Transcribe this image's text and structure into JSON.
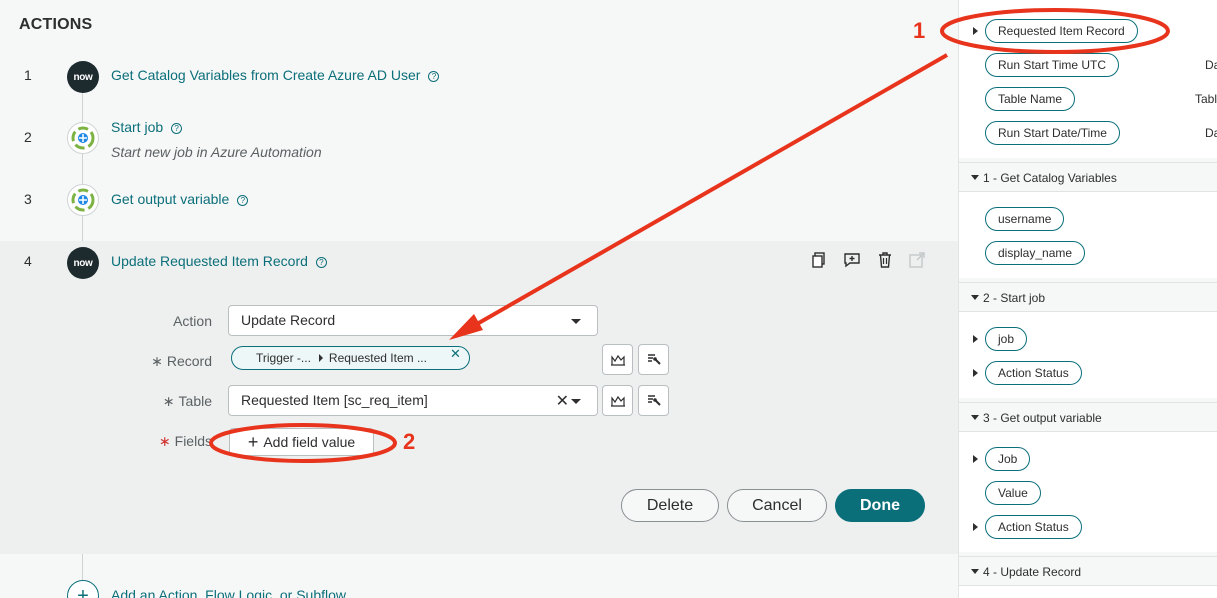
{
  "actions_title": "ACTIONS",
  "steps": [
    {
      "num": "1",
      "icon": "now",
      "title": "Get Catalog Variables from Create Azure AD User",
      "help": "?"
    },
    {
      "num": "2",
      "icon": "azure",
      "title": "Start job",
      "subtitle": "Start new job in Azure Automation",
      "help": "?"
    },
    {
      "num": "3",
      "icon": "azure",
      "title": "Get output variable",
      "help": "?"
    },
    {
      "num": "4",
      "icon": "now",
      "title": "Update Requested Item Record",
      "help": "?"
    }
  ],
  "now_icon_text": "now",
  "form": {
    "action_label": "Action",
    "action_value": "Update Record",
    "record_label": "Record",
    "record_pill_left": "Trigger -...",
    "record_pill_right": "Requested Item ...",
    "table_label": "Table",
    "table_value": "Requested Item [sc_req_item]",
    "fields_label": "Fields",
    "add_field_label": "Add field value",
    "required_mark": "∗"
  },
  "buttons": {
    "delete": "Delete",
    "cancel": "Cancel",
    "done": "Done"
  },
  "add_action_text": "Add an Action, Flow Logic, or Subflow",
  "right_panel": {
    "trigger_pills": [
      {
        "label": "Requested Item Record",
        "expandable": true,
        "type": ""
      },
      {
        "label": "Run Start Time UTC",
        "expandable": false,
        "type": "Da"
      },
      {
        "label": "Table Name",
        "expandable": false,
        "type": "Tabl"
      },
      {
        "label": "Run Start Date/Time",
        "expandable": false,
        "type": "Da"
      }
    ],
    "sections": [
      {
        "title": "1 - Get Catalog Variables",
        "pills": [
          {
            "label": "username",
            "expandable": false
          },
          {
            "label": "display_name",
            "expandable": false
          }
        ]
      },
      {
        "title": "2 - Start job",
        "pills": [
          {
            "label": "job",
            "expandable": true
          },
          {
            "label": "Action Status",
            "expandable": true
          }
        ]
      },
      {
        "title": "3 - Get output variable",
        "pills": [
          {
            "label": "Job",
            "expandable": true
          },
          {
            "label": "Value",
            "expandable": false
          },
          {
            "label": "Action Status",
            "expandable": true
          }
        ]
      },
      {
        "title": "4 - Update Record",
        "pills": []
      }
    ]
  },
  "annotations": {
    "label_1": "1",
    "label_2": "2",
    "color": "#e8341c"
  },
  "colors": {
    "accent": "#0b6f7a",
    "background": "#f6f7f7"
  }
}
